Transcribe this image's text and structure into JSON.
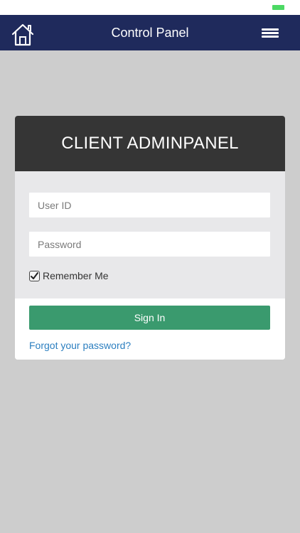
{
  "status_bar": {
    "battery_color": "#4cd964"
  },
  "navbar": {
    "title": "Control Panel",
    "background": "#1f2a5c",
    "left_icon": "home-icon",
    "right_icon": "hamburger-menu-icon"
  },
  "login_card": {
    "title": "CLIENT ADMINPANEL",
    "user_id": {
      "placeholder": "User ID",
      "value": ""
    },
    "password": {
      "placeholder": "Password",
      "value": ""
    },
    "remember_me": {
      "label": "Remember Me",
      "checked": true
    },
    "sign_in_label": "Sign In",
    "sign_in_color": "#3a9a6e",
    "forgot_password_label": "Forgot your password?",
    "link_color": "#2c7fc0"
  }
}
